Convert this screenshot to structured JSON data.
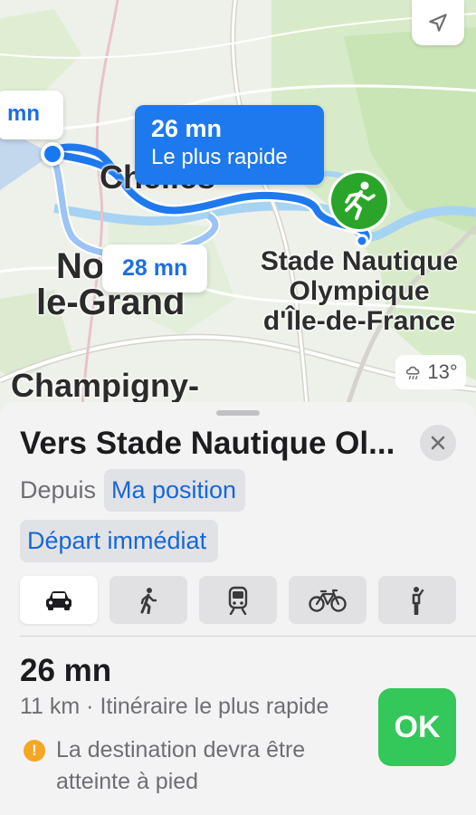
{
  "map": {
    "bubble_left": "mn",
    "route_primary": {
      "time": "26 mn",
      "label": "Le plus rapide"
    },
    "route_alt": {
      "time": "28 mn"
    },
    "labels": {
      "chelles": "Chelles",
      "noisy_line1": "No",
      "noisy_line2": "le-Grand",
      "champigny": "Champigny-"
    },
    "destination_lines": [
      "Stade Nautique",
      "Olympique",
      "d'Île-de-France"
    ],
    "weather": {
      "temperature": "13°",
      "icon": "rain-cloud-icon"
    },
    "colors": {
      "route": "#1e79ee",
      "route_alt": "#9cc3f5",
      "destination_pin": "#2aa52a",
      "user_dot": "#1778f2"
    }
  },
  "sheet": {
    "title": "Vers Stade Nautique Ol...",
    "from_label": "Depuis",
    "from_value": "Ma position",
    "departure": "Départ immédiat",
    "transport_modes": [
      {
        "mode": "car",
        "icon": "car-icon",
        "selected": true
      },
      {
        "mode": "walk",
        "icon": "walking-icon",
        "selected": false
      },
      {
        "mode": "transit",
        "icon": "train-icon",
        "selected": false
      },
      {
        "mode": "bike",
        "icon": "bicycle-icon",
        "selected": false
      },
      {
        "mode": "ride",
        "icon": "rideshare-icon",
        "selected": false
      }
    ],
    "route": {
      "time": "26 mn",
      "meta": "11 km · Itinéraire le plus rapide",
      "warning": "La destination devra être atteinte à pied",
      "ok_label": "OK"
    },
    "colors": {
      "ok": "#34c759",
      "link": "#1667d6",
      "warning": "#f5a623"
    }
  }
}
